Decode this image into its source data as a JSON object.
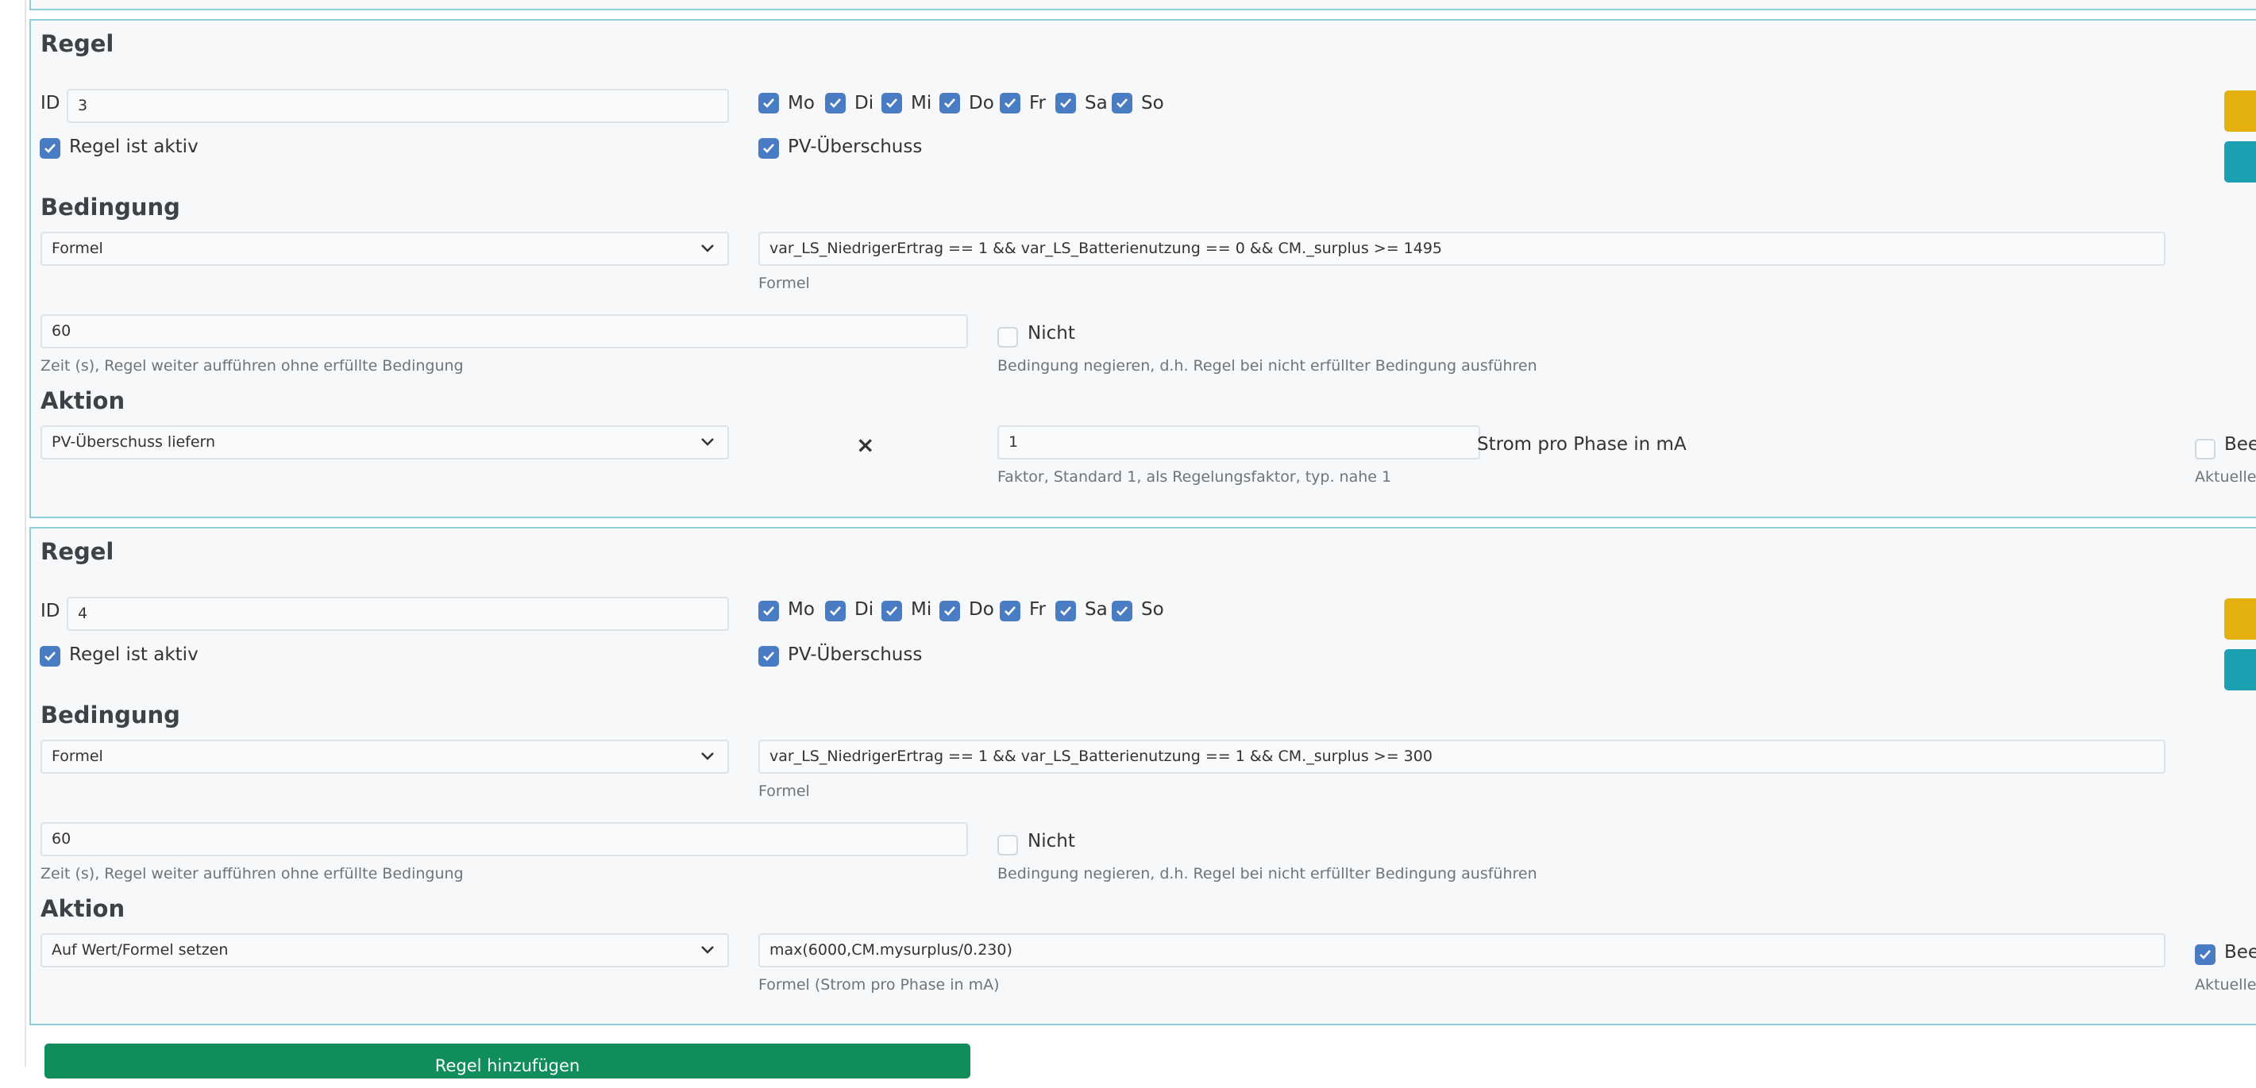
{
  "add_rule_label": "Regel hinzufügen",
  "rules": [
    {
      "title": "Regel",
      "id_label": "ID",
      "id_value": "3",
      "days": [
        {
          "label": "Mo",
          "checked": true
        },
        {
          "label": "Di",
          "checked": true
        },
        {
          "label": "Mi",
          "checked": true
        },
        {
          "label": "Do",
          "checked": true
        },
        {
          "label": "Fr",
          "checked": true
        },
        {
          "label": "Sa",
          "checked": true
        },
        {
          "label": "So",
          "checked": true
        }
      ],
      "active_label": "Regel ist aktiv",
      "active_checked": true,
      "pv_label": "PV-Überschuss",
      "pv_checked": true,
      "condition_heading": "Bedingung",
      "condition_type": "Formel",
      "condition_formula": "var_LS_NiedrigerErtrag == 1 && var_LS_Batterienutzung == 0 && CM._surplus >= 1495",
      "condition_formula_help": "Formel",
      "time_value": "60",
      "time_help": "Zeit (s), Regel weiter aufführen ohne erfüllte Bedingung",
      "not_label": "Nicht",
      "not_checked": false,
      "not_help": "Bedingung negieren, d.h. Regel bei nicht erfüllter Bedingung ausführen",
      "action_heading": "Aktion",
      "action_type": "PV-Überschuss liefern",
      "multiply_symbol": "×",
      "factor_value": "1",
      "factor_help": "Faktor, Standard 1, als Regelungsfaktor, typ. nahe 1",
      "unit_text": "Strom pro Phase in mA",
      "right_check_label": "Beer",
      "right_check_checked": false,
      "right_help": "Aktueller"
    },
    {
      "title": "Regel",
      "id_label": "ID",
      "id_value": "4",
      "days": [
        {
          "label": "Mo",
          "checked": true
        },
        {
          "label": "Di",
          "checked": true
        },
        {
          "label": "Mi",
          "checked": true
        },
        {
          "label": "Do",
          "checked": true
        },
        {
          "label": "Fr",
          "checked": true
        },
        {
          "label": "Sa",
          "checked": true
        },
        {
          "label": "So",
          "checked": true
        }
      ],
      "active_label": "Regel ist aktiv",
      "active_checked": true,
      "pv_label": "PV-Überschuss",
      "pv_checked": true,
      "condition_heading": "Bedingung",
      "condition_type": "Formel",
      "condition_formula": "var_LS_NiedrigerErtrag == 1 && var_LS_Batterienutzung == 1 && CM._surplus >= 300",
      "condition_formula_help": "Formel",
      "time_value": "60",
      "time_help": "Zeit (s), Regel weiter aufführen ohne erfüllte Bedingung",
      "not_label": "Nicht",
      "not_checked": false,
      "not_help": "Bedingung negieren, d.h. Regel bei nicht erfüllter Bedingung ausführen",
      "action_heading": "Aktion",
      "action_type": "Auf Wert/Formel setzen",
      "action_formula": "max(6000,CM.mysurplus/0.230)",
      "action_formula_help": "Formel (Strom pro Phase in mA)",
      "right_check_label": "Beer",
      "right_check_checked": true,
      "right_help": "Aktueller"
    }
  ]
}
